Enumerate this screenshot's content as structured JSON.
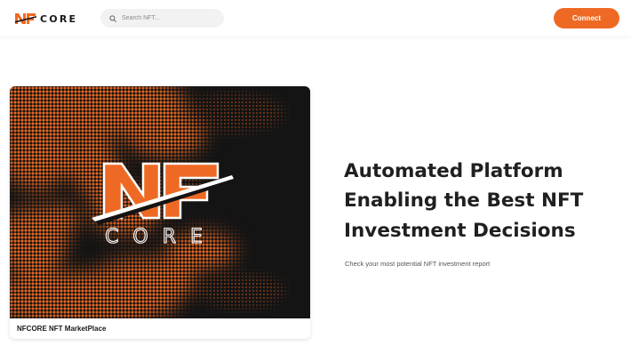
{
  "header": {
    "logo_text": "CORE",
    "search": {
      "placeholder": "Search NFT..."
    },
    "connect_label": "Connect"
  },
  "hero": {
    "title_lines": [
      "Automated Platform",
      "Enabling the Best NFT",
      "Investment Decisions"
    ],
    "subtitle": "Check your most potential NFT investment report"
  },
  "card": {
    "caption": "NFCORE NFT MarketPlace",
    "art_letters": "NF",
    "art_word": "CORE"
  },
  "colors": {
    "accent": "#ee6a24",
    "card_art_background": "#141414"
  },
  "icons": {
    "search": "search-icon",
    "logo": "nf-logo-icon"
  }
}
